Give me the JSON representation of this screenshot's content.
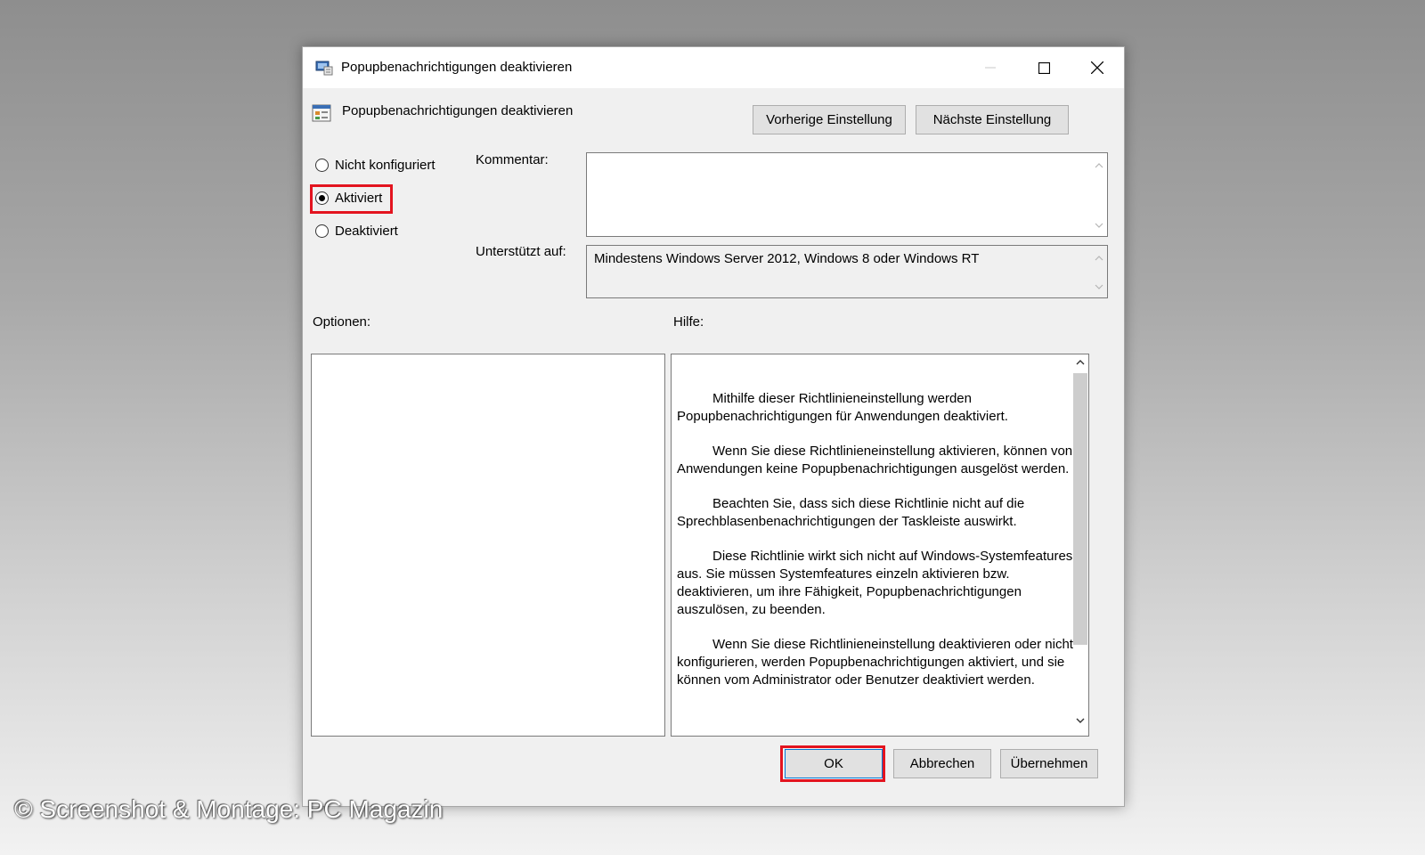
{
  "window": {
    "title": "Popupbenachrichtigungen deaktivieren",
    "icon": "group-policy-icon"
  },
  "header": {
    "policy_name": "Popupbenachrichtigungen deaktivieren",
    "prev_button": "Vorherige Einstellung",
    "next_button": "Nächste Einstellung"
  },
  "state": {
    "options": [
      {
        "label": "Nicht konfiguriert",
        "checked": false
      },
      {
        "label": "Aktiviert",
        "checked": true
      },
      {
        "label": "Deaktiviert",
        "checked": false
      }
    ]
  },
  "comment": {
    "label": "Kommentar:",
    "value": ""
  },
  "supported": {
    "label": "Unterstützt auf:",
    "value": "Mindestens Windows Server 2012, Windows 8 oder Windows RT"
  },
  "options_label": "Optionen:",
  "help": {
    "label": "Hilfe:",
    "paragraphs": [
      "Mithilfe dieser Richtlinieneinstellung werden Popupbenachrichtigungen für Anwendungen deaktiviert.",
      "Wenn Sie diese Richtlinieneinstellung aktivieren, können von Anwendungen keine Popupbenachrichtigungen ausgelöst werden.",
      "Beachten Sie, dass sich diese Richtlinie nicht auf die Sprechblasenbenachrichtigungen der Taskleiste auswirkt.",
      "Diese Richtlinie wirkt sich nicht auf Windows-Systemfeatures aus. Sie müssen Systemfeatures einzeln aktivieren bzw. deaktivieren, um ihre Fähigkeit, Popupbenachrichtigungen auszulösen, zu beenden.",
      "Wenn Sie diese Richtlinieneinstellung deaktivieren oder nicht konfigurieren, werden Popupbenachrichtigungen aktiviert, und sie können vom Administrator oder Benutzer deaktiviert werden."
    ]
  },
  "footer": {
    "ok": "OK",
    "cancel": "Abbrechen",
    "apply": "Übernehmen"
  },
  "colors": {
    "highlight": "#e3141f",
    "dialog_bg": "#f0f0f0"
  },
  "watermark": "© Screenshot & Montage: PC Magazin"
}
